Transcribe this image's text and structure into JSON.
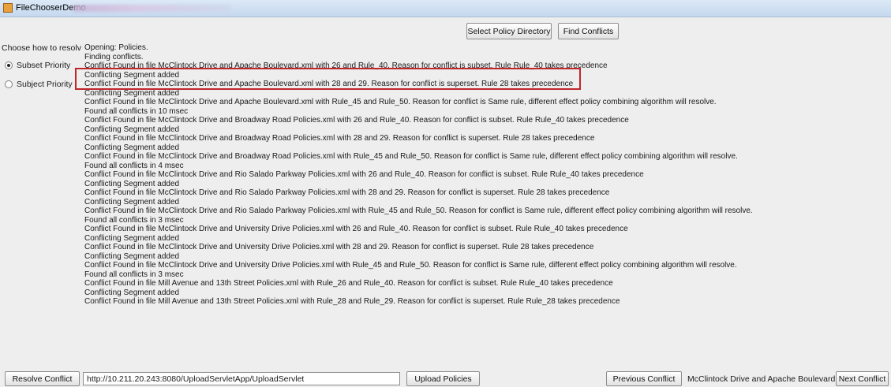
{
  "window": {
    "title": "FileChooserDemo"
  },
  "toolbar": {
    "select_policy_directory": "Select Policy Directory",
    "find_conflicts": "Find Conflicts"
  },
  "left_panel": {
    "label": "Choose how to resolve",
    "options": [
      {
        "label": "Subset Priority",
        "checked": true
      },
      {
        "label": "Subject Priority",
        "checked": false
      }
    ]
  },
  "log_lines": [
    "Opening: Policies.",
    "Finding conflicts.",
    "Conflict Found in file McClintock Drive and Apache Boulevard.xml with 26 and Rule_40. Reason for conflict is subset. Rule Rule_40 takes precedence",
    "Conflicting Segment added",
    "Conflict Found in file McClintock Drive and Apache Boulevard.xml with 28 and 29. Reason for conflict is superset. Rule 28 takes precedence",
    "Conflicting Segment added",
    "Conflict Found in file McClintock Drive and Apache Boulevard.xml with Rule_45 and Rule_50. Reason for conflict is Same rule, different effect policy combining algorithm will resolve.",
    "Found all conflicts in 10 msec",
    "Conflict Found in file McClintock Drive and Broadway Road Policies.xml with 26 and Rule_40. Reason for conflict is subset. Rule Rule_40 takes precedence",
    "Conflicting Segment added",
    "Conflict Found in file McClintock Drive and Broadway Road Policies.xml with 28 and 29. Reason for conflict is superset. Rule 28 takes precedence",
    "Conflicting Segment added",
    "Conflict Found in file McClintock Drive and Broadway Road Policies.xml with Rule_45 and Rule_50. Reason for conflict is Same rule, different effect policy combining algorithm will resolve.",
    "Found all conflicts in 4 msec",
    "Conflict Found in file McClintock Drive and Rio Salado Parkway Policies.xml with 26 and Rule_40. Reason for conflict is subset. Rule Rule_40 takes precedence",
    "Conflicting Segment added",
    "Conflict Found in file McClintock Drive and Rio Salado Parkway Policies.xml with 28 and 29. Reason for conflict is superset. Rule 28 takes precedence",
    "Conflicting Segment added",
    "Conflict Found in file McClintock Drive and Rio Salado Parkway Policies.xml with Rule_45 and Rule_50. Reason for conflict is Same rule, different effect policy combining algorithm will resolve.",
    "Found all conflicts in 3 msec",
    "Conflict Found in file McClintock Drive and University Drive Policies.xml with 26 and Rule_40. Reason for conflict is subset. Rule Rule_40 takes precedence",
    "Conflicting Segment added",
    "Conflict Found in file McClintock Drive and University Drive Policies.xml with 28 and 29. Reason for conflict is superset. Rule 28 takes precedence",
    "Conflicting Segment added",
    "Conflict Found in file McClintock Drive and University Drive Policies.xml with Rule_45 and Rule_50. Reason for conflict is Same rule, different effect policy combining algorithm will resolve.",
    "Found all conflicts in 3 msec",
    "Conflict Found in file Mill Avenue and 13th Street Policies.xml with Rule_26 and Rule_40. Reason for conflict is subset. Rule Rule_40 takes precedence",
    "Conflicting Segment added",
    "Conflict Found in file Mill Avenue and 13th Street Policies.xml with Rule_28 and Rule_29. Reason for conflict is superset. Rule Rule_28 takes precedence"
  ],
  "bottom_bar": {
    "resolve_conflict": "Resolve Conflict",
    "url_value": "http://10.211.20.243:8080/UploadServletApp/UploadServlet",
    "upload_policies": "Upload Policies",
    "previous_conflict": "Previous Conflict",
    "current_file": "McClintock Drive and Apache Boulevard.xml",
    "next_conflict": "Next Conflict"
  },
  "colors": {
    "highlight_border": "#c0262c",
    "background": "#eeeeee"
  }
}
